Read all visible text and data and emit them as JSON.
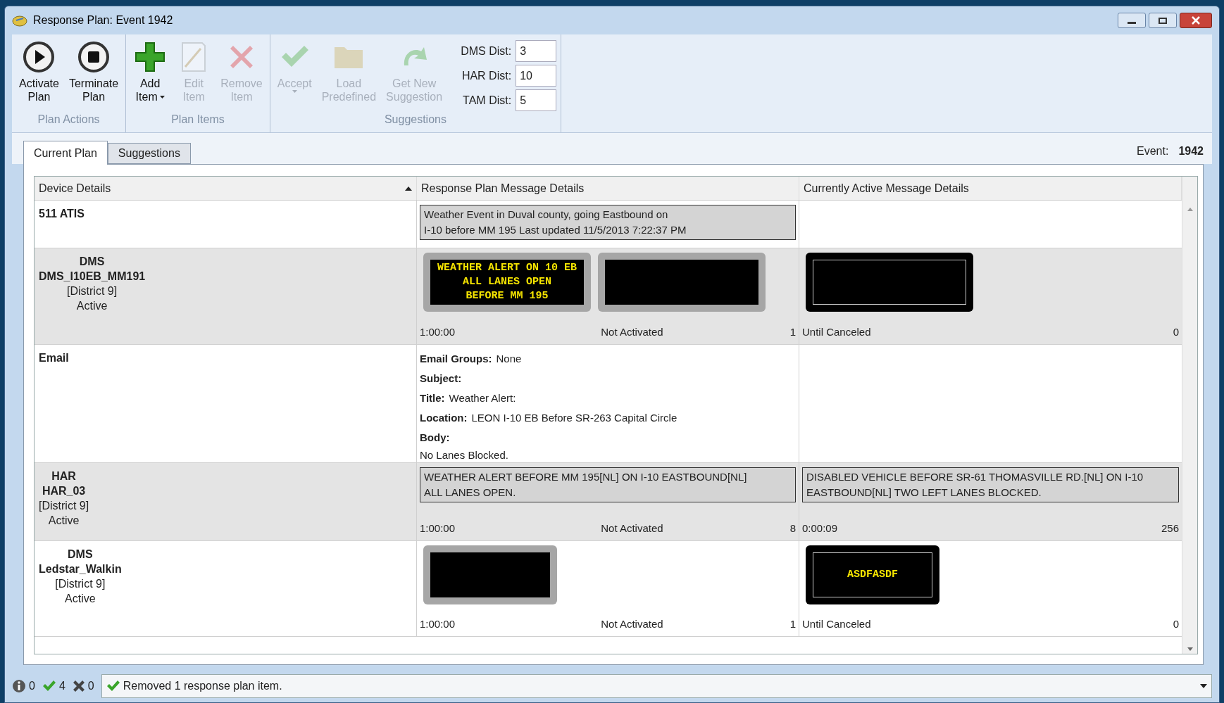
{
  "window": {
    "title": "Response Plan: Event 1942"
  },
  "ribbon": {
    "groups": [
      {
        "label": "Plan Actions",
        "buttons": [
          {
            "kind": "play",
            "lines": [
              "Activate",
              "Plan"
            ],
            "disabled": false,
            "dropdown": false
          },
          {
            "kind": "stop",
            "lines": [
              "Terminate",
              "Plan"
            ],
            "disabled": false,
            "dropdown": false
          }
        ]
      },
      {
        "label": "Plan Items",
        "buttons": [
          {
            "kind": "add",
            "lines": [
              "Add",
              "Item"
            ],
            "disabled": false,
            "dropdown": true
          },
          {
            "kind": "edit",
            "lines": [
              "Edit",
              "Item"
            ],
            "disabled": true,
            "dropdown": false
          },
          {
            "kind": "remove",
            "lines": [
              "Remove",
              "Item"
            ],
            "disabled": true,
            "dropdown": false
          }
        ]
      },
      {
        "label": "Suggestions",
        "buttons": [
          {
            "kind": "accept",
            "lines": [
              "Accept"
            ],
            "disabled": true,
            "dropdown": true
          },
          {
            "kind": "folder",
            "lines": [
              "Load",
              "Predefined"
            ],
            "disabled": true,
            "dropdown": false
          },
          {
            "kind": "refresh",
            "lines": [
              "Get New",
              "Suggestion"
            ],
            "disabled": true,
            "dropdown": false
          }
        ],
        "fields": [
          {
            "label": "DMS Dist:",
            "value": "3"
          },
          {
            "label": "HAR Dist:",
            "value": "10"
          },
          {
            "label": "TAM Dist:",
            "value": "5"
          }
        ]
      }
    ]
  },
  "tabs": [
    {
      "label": "Current Plan",
      "selected": true
    },
    {
      "label": "Suggestions",
      "selected": false
    }
  ],
  "event": {
    "label": "Event:",
    "value": "1942"
  },
  "table": {
    "columns": [
      {
        "label": "Device Details",
        "sorted": true
      },
      {
        "label": "Response Plan Message Details",
        "sorted": false
      },
      {
        "label": "Currently Active Message Details",
        "sorted": false
      }
    ],
    "rows": [
      {
        "device": {
          "centered": false,
          "lines": [
            {
              "text": "511 ATIS",
              "bold": true
            }
          ]
        },
        "plan": {
          "kind": "text",
          "lines": [
            "Weather Event in Duval county, going Eastbound on",
            "I-10 before MM 195 Last updated 11/5/2013 7:22:37 PM"
          ]
        },
        "active": {
          "kind": "empty"
        }
      },
      {
        "device": {
          "centered": true,
          "lines": [
            {
              "text": "DMS",
              "bold": true
            },
            {
              "text": "DMS_I10EB_MM191",
              "bold": true
            },
            {
              "text": "[District 9]",
              "bold": false
            },
            {
              "text": "Active",
              "bold": false
            }
          ]
        },
        "plan": {
          "kind": "signs",
          "signs": [
            {
              "kind": "wide",
              "activated": false,
              "lines": [
                "WEATHER ALERT ON 10 EB",
                "ALL LANES OPEN",
                "BEFORE MM 195"
              ]
            },
            {
              "kind": "wide",
              "activated": false
            }
          ],
          "footer": {
            "duration": "1:00:00",
            "status": "Not Activated",
            "count": "1"
          }
        },
        "active": {
          "kind": "signs",
          "signs": [
            {
              "kind": "wide",
              "activated": true
            }
          ],
          "footer": {
            "duration": "Until Canceled",
            "count": "0"
          }
        }
      },
      {
        "device": {
          "centered": false,
          "lines": [
            {
              "text": "Email",
              "bold": true
            }
          ]
        },
        "plan": {
          "kind": "email",
          "fields": [
            {
              "label": "Email Groups:",
              "value": "None"
            },
            {
              "label": "Subject:"
            },
            {
              "label": "Title:",
              "value": "Weather Alert:"
            },
            {
              "label": "Location:",
              "value": "LEON I-10 EB Before SR-263 Capital Circle"
            },
            {
              "label": "Body:"
            }
          ],
          "body": "No Lanes Blocked."
        },
        "active": {
          "kind": "empty"
        }
      },
      {
        "device": {
          "centered": true,
          "lines": [
            {
              "text": "HAR",
              "bold": true
            },
            {
              "text": "HAR_03",
              "bold": true
            },
            {
              "text": "[District 9]",
              "bold": false
            },
            {
              "text": "Active",
              "bold": false
            }
          ]
        },
        "plan": {
          "kind": "text",
          "lines": [
            "WEATHER ALERT BEFORE MM 195[NL] ON I-10 EASTBOUND[NL]",
            "ALL LANES OPEN."
          ],
          "footer": {
            "duration": "1:00:00",
            "status": "Not Activated",
            "count": "8"
          }
        },
        "active": {
          "kind": "text",
          "lines": [
            "DISABLED VEHICLE BEFORE SR-61 THOMASVILLE RD.[NL] ON I-10",
            "EASTBOUND[NL] TWO LEFT LANES BLOCKED."
          ],
          "footer": {
            "duration": "0:00:09",
            "count": "256"
          }
        }
      },
      {
        "device": {
          "centered": true,
          "lines": [
            {
              "text": "DMS",
              "bold": true
            },
            {
              "text": "Ledstar_Walkin",
              "bold": true
            },
            {
              "text": "[District 9]",
              "bold": false
            },
            {
              "text": "Active",
              "bold": false
            }
          ]
        },
        "plan": {
          "kind": "signs",
          "signs": [
            {
              "kind": "compact",
              "activated": false
            }
          ],
          "footer": {
            "duration": "1:00:00",
            "status": "Not Activated",
            "count": "1"
          }
        },
        "active": {
          "kind": "signs",
          "signs": [
            {
              "kind": "compact",
              "activated": true,
              "lines": [
                "ASDFASDF"
              ]
            }
          ],
          "footer": {
            "duration": "Until Canceled",
            "count": "0"
          }
        }
      }
    ]
  },
  "status_bar": {
    "counts": [
      {
        "kind": "info",
        "value": "0"
      },
      {
        "kind": "ok",
        "value": "4"
      },
      {
        "kind": "error",
        "value": "0"
      }
    ],
    "message": {
      "kind": "ok",
      "text": "Removed 1 response plan item."
    }
  }
}
